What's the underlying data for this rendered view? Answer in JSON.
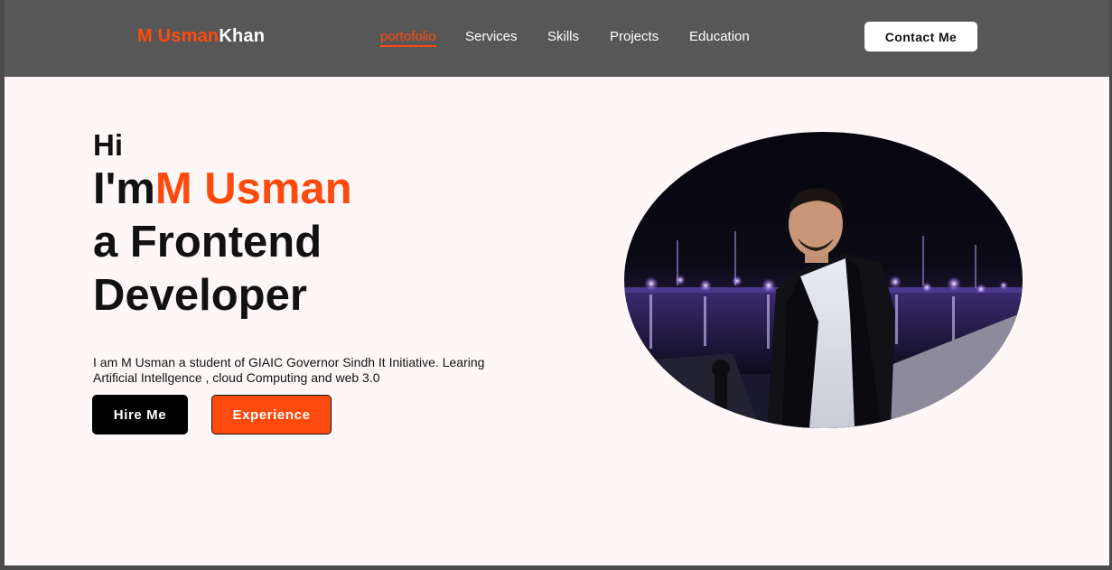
{
  "nav": {
    "logo_first": "M Usman",
    "logo_second": "Khan",
    "links": [
      {
        "label": "portofolio"
      },
      {
        "label": "Services"
      },
      {
        "label": "Skills"
      },
      {
        "label": "Projects"
      },
      {
        "label": "Education"
      }
    ],
    "contact_label": "Contact Me"
  },
  "hero": {
    "greeting": "Hi",
    "intro_prefix": "I'm",
    "name": "M Usman",
    "role_line1": "a Frontend",
    "role_line2": "Developer",
    "description": "I am M Usman a student of GIAIC Governor Sindh It Initiative. Learing Artificial Intellgence , cloud Computing and web 3.0",
    "hire_label": "Hire Me",
    "experience_label": "Experience"
  },
  "colors": {
    "accent": "#ff4a0d",
    "nav_bg": "#585757",
    "page_bg": "#fdf8f7"
  }
}
